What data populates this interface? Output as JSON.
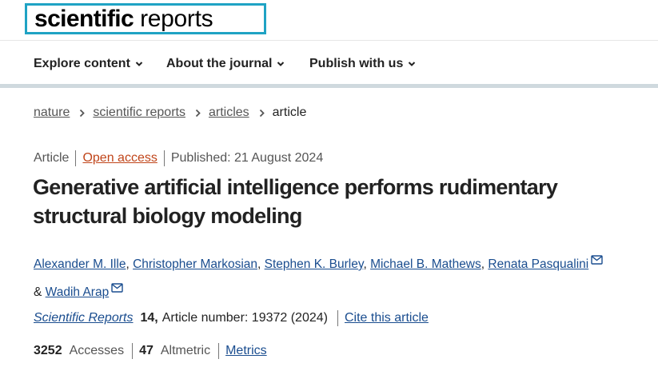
{
  "logo": {
    "bold": "scientific",
    "light": "reports"
  },
  "nav": [
    {
      "label": "Explore content"
    },
    {
      "label": "About the journal"
    },
    {
      "label": "Publish with us"
    }
  ],
  "breadcrumb": {
    "items": [
      "nature",
      "scientific reports",
      "articles"
    ],
    "current": "article"
  },
  "article": {
    "type": "Article",
    "access": "Open access",
    "published": "Published: 21 August 2024",
    "title": "Generative artificial intelligence performs rudimentary structural biology modeling",
    "authors": [
      {
        "name": "Alexander M. Ille",
        "mail": false
      },
      {
        "name": "Christopher Markosian",
        "mail": false
      },
      {
        "name": "Stephen K. Burley",
        "mail": false
      },
      {
        "name": "Michael B. Mathews",
        "mail": false
      },
      {
        "name": "Renata Pasqualini",
        "mail": true
      },
      {
        "name": "Wadih Arap",
        "mail": true
      }
    ],
    "author_separator": ",",
    "author_last_separator": "&"
  },
  "citation": {
    "journal": "Scientific Reports",
    "volume": "14,",
    "article_number": "Article number: 19372 (2024)",
    "cite_link": "Cite this article"
  },
  "metrics": {
    "accesses_value": "3252",
    "accesses_label": "Accesses",
    "altmetric_value": "47",
    "altmetric_label": "Altmetric",
    "metrics_link": "Metrics"
  },
  "colors": {
    "logo_border": "#1fa3c4",
    "link": "#1a4d8f",
    "open_access": "#c0451a",
    "nav_underline": "#cfd9de"
  }
}
